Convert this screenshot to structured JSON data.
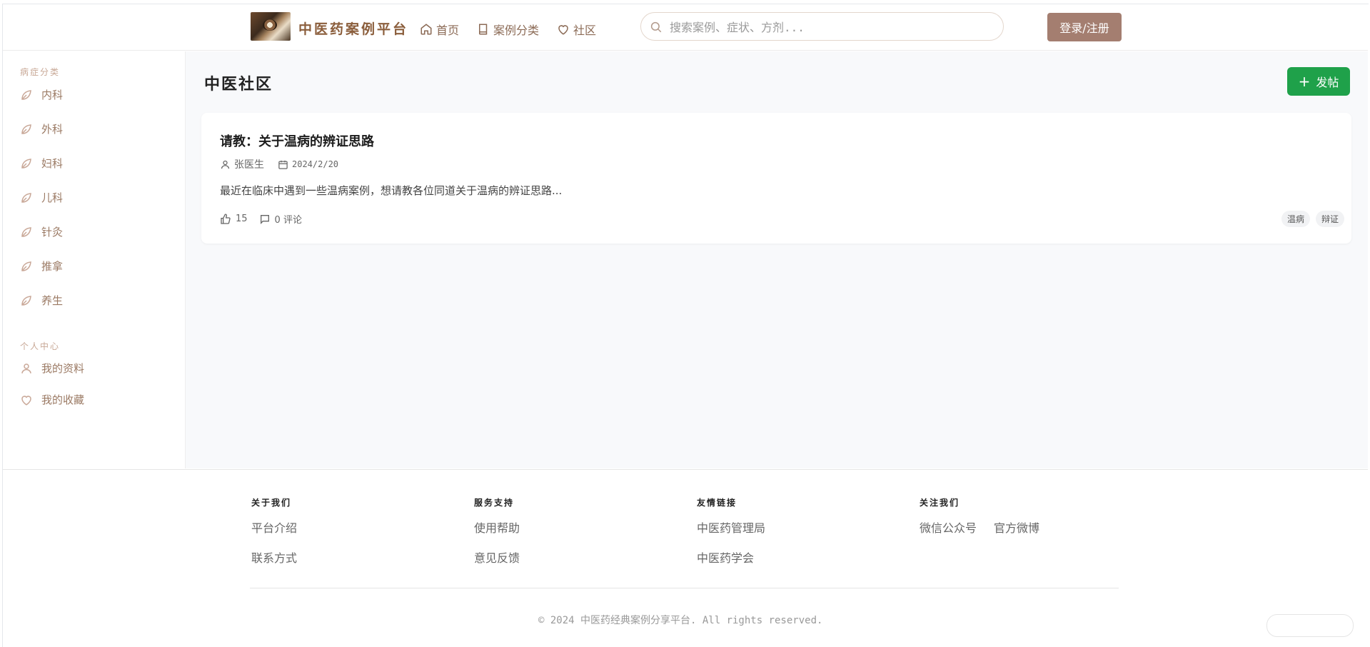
{
  "header": {
    "logo_text": "中医药案例平台",
    "nav": [
      {
        "label": "首页",
        "icon": "home-icon"
      },
      {
        "label": "案例分类",
        "icon": "book-icon"
      },
      {
        "label": "社区",
        "icon": "heart-icon"
      }
    ],
    "search_placeholder": "搜索案例、症状、方剂...",
    "login_label": "登录/注册"
  },
  "sidebar": {
    "section1_title": "病症分类",
    "items": [
      {
        "label": "内科",
        "icon": "leaf-icon"
      },
      {
        "label": "外科",
        "icon": "leaf-icon"
      },
      {
        "label": "妇科",
        "icon": "leaf-icon"
      },
      {
        "label": "儿科",
        "icon": "leaf-icon"
      },
      {
        "label": "针灸",
        "icon": "leaf-icon"
      },
      {
        "label": "推拿",
        "icon": "leaf-icon"
      },
      {
        "label": "养生",
        "icon": "leaf-icon"
      }
    ],
    "section2_title": "个人中心",
    "personal": [
      {
        "label": "我的资料",
        "icon": "user-icon"
      },
      {
        "label": "我的收藏",
        "icon": "heart-icon"
      }
    ]
  },
  "main": {
    "title": "中医社区",
    "post_button": "发帖",
    "posts": [
      {
        "title": "请教：关于温病的辨证思路",
        "author": "张医生",
        "date": "2024/2/20",
        "excerpt": "最近在临床中遇到一些温病案例，想请教各位同道关于温病的辨证思路...",
        "likes": "15",
        "comments": "0 评论",
        "tags": [
          "温病",
          "辩证"
        ]
      }
    ]
  },
  "footer": {
    "columns": [
      {
        "title": "关于我们",
        "links": [
          "平台介绍",
          "联系方式"
        ]
      },
      {
        "title": "服务支持",
        "links": [
          "使用帮助",
          "意见反馈"
        ]
      },
      {
        "title": "友情链接",
        "links": [
          "中医药管理局",
          "中医药学会"
        ]
      },
      {
        "title": "关注我们",
        "links": [
          "微信公众号",
          "官方微博"
        ]
      }
    ],
    "copyright": "© 2024 中医药经典案例分享平台. All rights reserved."
  },
  "colors": {
    "accent": "#a47e70",
    "brand": "#8b5e3c",
    "post_button": "#1fa14a"
  }
}
